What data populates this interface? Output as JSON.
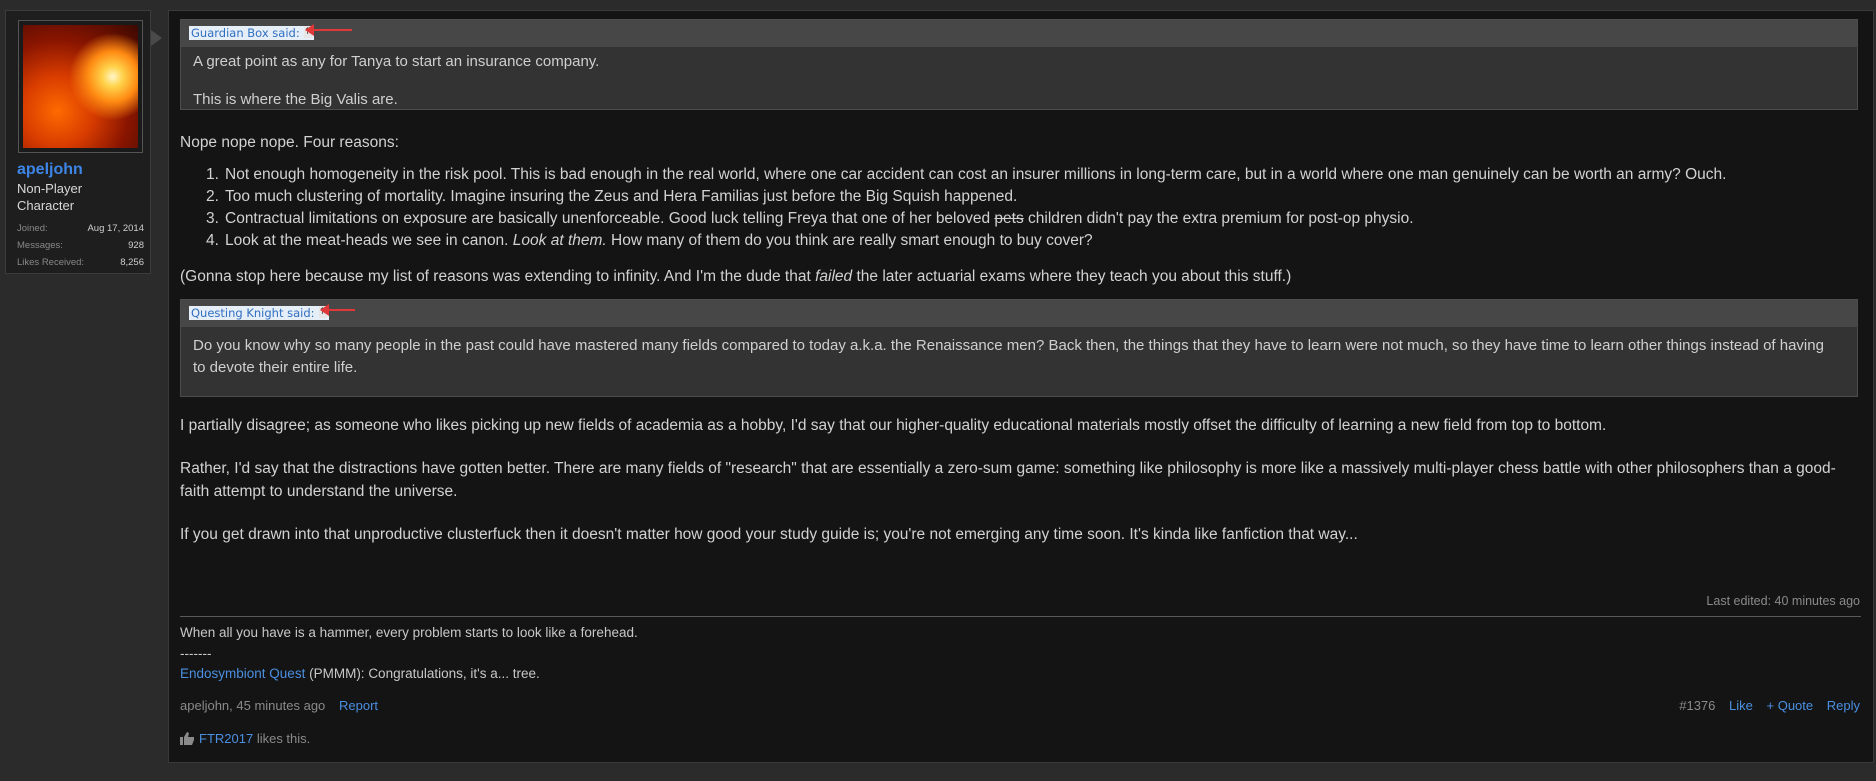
{
  "user": {
    "name": "apeljohn",
    "title": "Non-Player Character",
    "stats": [
      {
        "label": "Joined:",
        "value": "Aug 17, 2014"
      },
      {
        "label": "Messages:",
        "value": "928"
      },
      {
        "label": "Likes Received:",
        "value": "8,256"
      }
    ]
  },
  "quotes": [
    {
      "attribution": "Guardian Box said:",
      "up_glyph": "↑",
      "lines": [
        "A great point as any for Tanya to start an insurance company.",
        "This is where the Big Valis are."
      ]
    },
    {
      "attribution": "Questing Knight said:",
      "up_glyph": "↑",
      "lines": [
        "Do you know why so many people in the past could have mastered many fields compared to today a.k.a. the Renaissance men? Back then, the things that they have to learn were not much, so they have time to learn other things instead of having to devote their entire life."
      ]
    }
  ],
  "body": {
    "intro": "Nope nope nope. Four reasons:",
    "reasons": [
      {
        "num": "1.",
        "text": "Not enough homogeneity in the risk pool. This is bad enough in the real world, where one car accident can cost an insurer millions in long-term care, but in a world where one man genuinely can be worth an army? Ouch."
      },
      {
        "num": "2.",
        "text": "Too much clustering of mortality. Imagine insuring the Zeus and Hera Familias just before the Big Squish happened."
      },
      {
        "num": "3.",
        "text_before": "Contractual limitations on exposure are basically unenforceable. Good luck telling Freya that one of her beloved ",
        "text_strike": "pets",
        "text_after": " children didn't pay the extra premium for post-op physio."
      },
      {
        "num": "4.",
        "text_before": "Look at the meat-heads we see in canon. ",
        "text_italic": "Look at them.",
        "text_after": " How many of them do you think are really smart enough to buy cover?"
      }
    ],
    "aside_before": "(Gonna stop here because my list of reasons was extending to infinity. And I'm the dude that ",
    "aside_italic": "failed",
    "aside_after": " the later actuarial exams where they teach you about this stuff.)",
    "para1": "I partially disagree; as someone who likes picking up new fields of academia as a hobby, I'd say that our higher-quality educational materials mostly offset the difficulty of learning a new field from top to bottom.",
    "para2": "Rather, I'd say that the distractions have gotten better. There are many fields of \"research\" that are essentially a zero-sum game: something like philosophy is more like a massively multi-player chess battle with other philosophers than a good-faith attempt to understand the universe.",
    "para3": "If you get drawn into that unproductive clusterfuck then it doesn't matter how good your study guide is; you're not emerging any time soon. It's kinda like fanfiction that way..."
  },
  "last_edited": "Last edited: 40 minutes ago",
  "signature": {
    "line1": "When all you have is a hammer, every problem starts to look like a forehead.",
    "line2": "-------",
    "link": "Endosymbiont Quest",
    "rest": " (PMMM): Congratulations, it's a... tree."
  },
  "meta": {
    "author_time": "apeljohn, 45 minutes ago",
    "report": "Report",
    "post_number": "#1376",
    "like": "Like",
    "quote": "+ Quote",
    "reply": "Reply"
  },
  "likes": {
    "user": "FTR2017",
    "suffix": " likes this."
  },
  "colors": {
    "link": "#4a8fe0",
    "username": "#3d86e6",
    "annotation_arrow": "#e03838"
  }
}
